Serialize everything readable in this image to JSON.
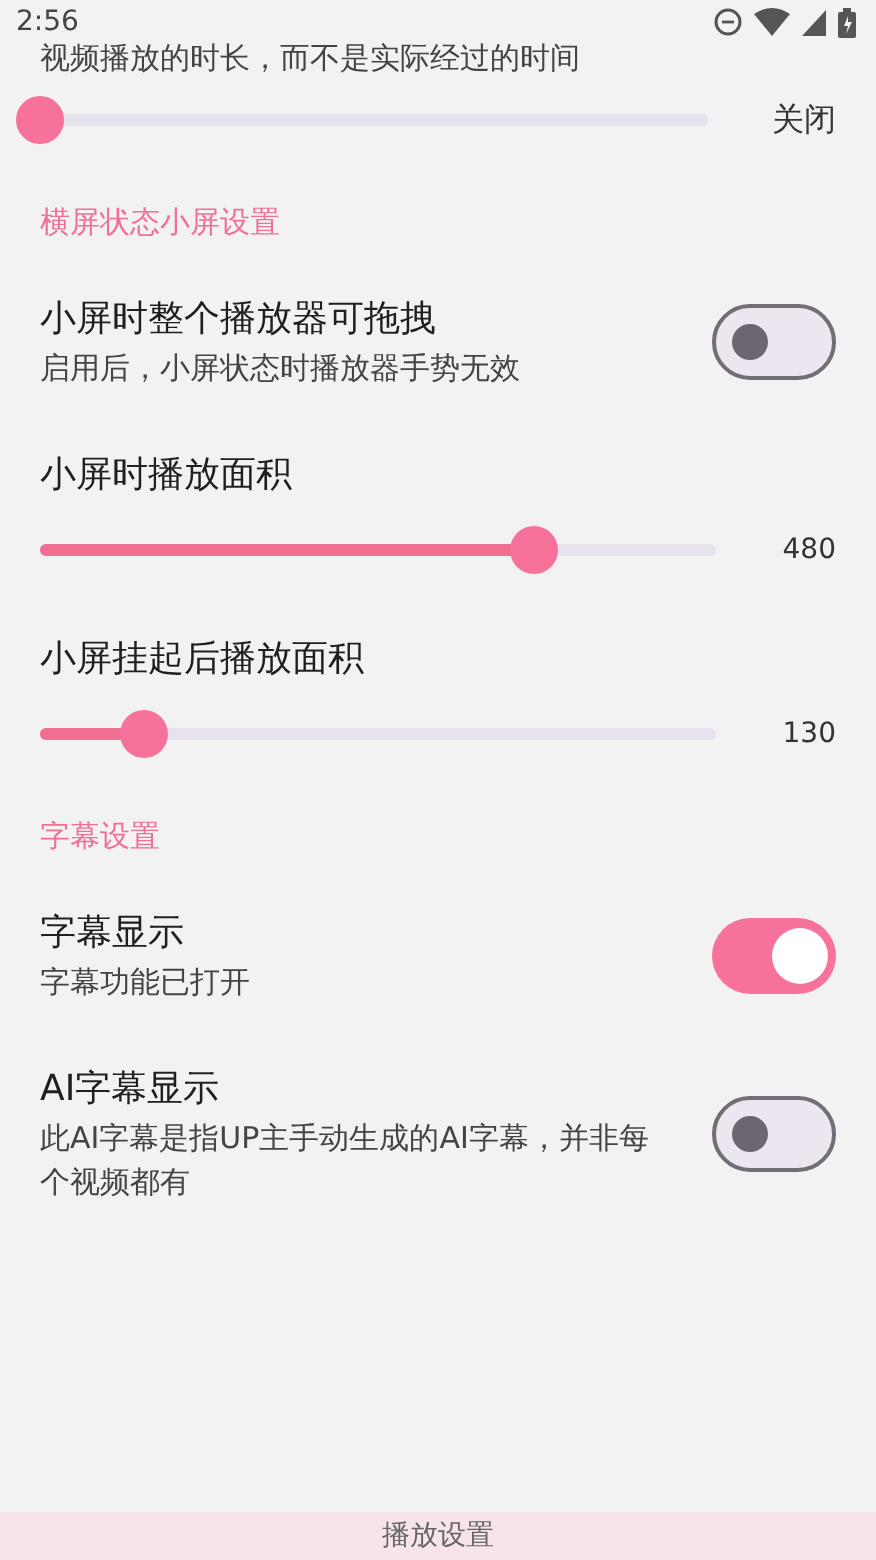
{
  "status_bar": {
    "time": "2:56"
  },
  "top_setting": {
    "description": "视频播放的时长，而不是实际经过的时间",
    "level": 0,
    "reading": "关闭"
  },
  "sections": [
    {
      "title": "横屏状态小屏设置",
      "items": [
        {
          "kind": "switch",
          "title": "小屏时整个播放器可拖拽",
          "description": "启用后，小屏状态时播放器手势无效",
          "on": false
        },
        {
          "kind": "slider",
          "title": "小屏时播放面积",
          "level": 0.73,
          "reading": "480"
        },
        {
          "kind": "slider",
          "title": "小屏挂起后播放面积",
          "level": 0.155,
          "reading": "130"
        }
      ]
    },
    {
      "title": "字幕设置",
      "items": [
        {
          "kind": "switch",
          "title": "字幕显示",
          "description": "字幕功能已打开",
          "on": true
        },
        {
          "kind": "switch",
          "title": "AI字幕显示",
          "description": "此AI字幕是指UP主手动生成的AI字幕，并非每个视频都有",
          "on": false
        }
      ]
    }
  ],
  "bottom_bar": {
    "title": "播放设置"
  }
}
